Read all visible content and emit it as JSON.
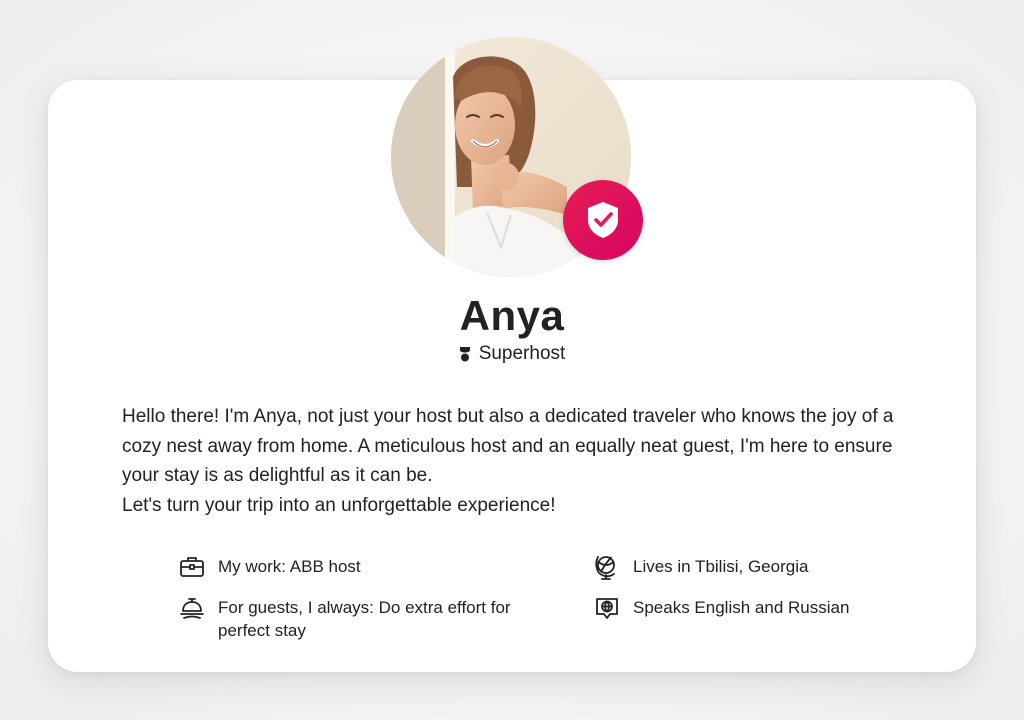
{
  "profile": {
    "name": "Anya",
    "role": "Superhost",
    "avatar_icon": "host-photo",
    "badge_icon": "shield-check-icon",
    "accent_color": "#e31c5f"
  },
  "bio": {
    "lines": [
      "Hello there! I'm Anya, not just your host but also a dedicated traveler who knows the joy of a cozy nest away from home. A meticulous host and an equally neat guest, I'm here to ensure your stay is as delightful as it can be.",
      "Let's turn your trip into an unforgettable experience!"
    ]
  },
  "facts": {
    "work": {
      "icon": "briefcase-icon",
      "text": "My work: ABB host"
    },
    "location": {
      "icon": "globe-stand-icon",
      "text": "Lives in Tbilisi, Georgia"
    },
    "guests": {
      "icon": "room-service-bell-icon",
      "text": "For guests, I always: Do extra effort for perfect stay"
    },
    "languages": {
      "icon": "speech-globe-icon",
      "text": "Speaks English and Russian"
    }
  }
}
